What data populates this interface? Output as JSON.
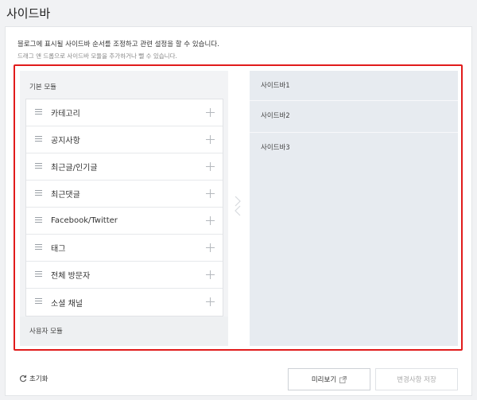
{
  "page": {
    "title": "사이드바"
  },
  "description": {
    "line1": "블로그에 표시될 사이드바 순서를 조정하고 관련 설정을 할 수 있습니다.",
    "line2": "드래그 앤 드롭으로 사이드바 모듈을 추가하거나 뺄 수 있습니다."
  },
  "left": {
    "basic_title": "기본 모듈",
    "modules": [
      {
        "label": "카테고리"
      },
      {
        "label": "공지사항"
      },
      {
        "label": "최근글/인기글"
      },
      {
        "label": "최근댓글"
      },
      {
        "label": "Facebook/Twitter"
      },
      {
        "label": "태그"
      },
      {
        "label": "전체 방문자"
      },
      {
        "label": "소셜 채널"
      }
    ],
    "user_title": "사용자 모듈"
  },
  "right": {
    "slots": [
      {
        "label": "사이드바1"
      },
      {
        "label": "사이드바2"
      },
      {
        "label": "사이드바3"
      }
    ]
  },
  "footer": {
    "reset_label": "초기화",
    "preview_label": "미리보기",
    "save_label": "변경사항 저장"
  },
  "colors": {
    "highlight_border": "#e11b1b",
    "right_bg": "#e7ebf0",
    "left_bg": "#f2f3f5"
  },
  "icons": {
    "drag": "drag-handle-icon",
    "add": "plus-icon",
    "reset": "refresh-icon",
    "external": "external-link-icon"
  }
}
